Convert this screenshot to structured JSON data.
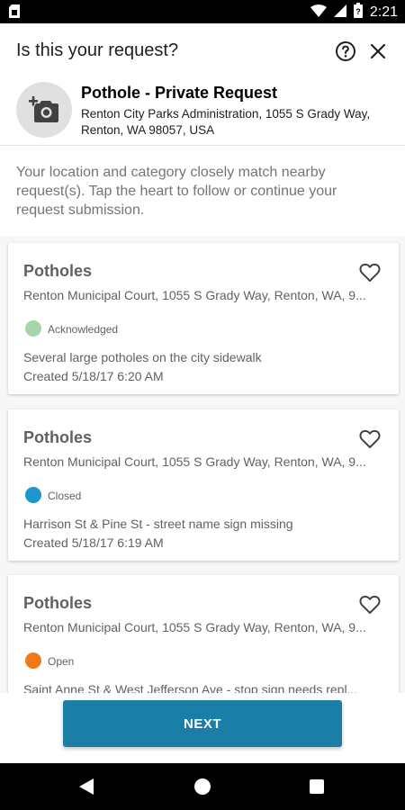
{
  "status_bar": {
    "time": "2:21",
    "icons": [
      "sim-card-icon",
      "wifi-icon",
      "signal-icon",
      "battery-icon"
    ]
  },
  "header": {
    "title": "Is this your request?",
    "help_icon": "help-circle-icon",
    "close_icon": "close-icon"
  },
  "request": {
    "icon": "add-photo-icon",
    "title": "Pothole - Private Request",
    "address": "Renton City Parks Administration, 1055 S Grady Way, Renton, WA 98057, USA"
  },
  "intro": "Your location and category closely match nearby request(s). Tap the heart to follow or continue your request submission.",
  "cards": [
    {
      "title": "Potholes",
      "address": "Renton Municipal Court, 1055 S Grady Way, Renton, WA, 9...",
      "status": "Acknowledged",
      "status_color": "#a5d6a7",
      "description": "Several large potholes on the city sidewalk",
      "created": "Created 5/18/17 6:20 AM"
    },
    {
      "title": "Potholes",
      "address": "Renton Municipal Court, 1055 S Grady Way, Renton, WA, 9...",
      "status": "Closed",
      "status_color": "#1e96cf",
      "description": "Harrison St & Pine St - street name sign missing",
      "created": "Created 5/18/17 6:19 AM"
    },
    {
      "title": "Potholes",
      "address": "Renton Municipal Court, 1055 S Grady Way, Renton, WA, 9...",
      "status": "Open",
      "status_color": "#ef7a1a",
      "description": "Saint Anne St & West Jefferson Ave - stop sign needs repl...",
      "created": ""
    }
  ],
  "footer": {
    "next_label": "NEXT",
    "button_color": "#1a7ea6"
  },
  "nav_bar": {
    "icons": [
      "back-icon",
      "home-icon",
      "recents-icon"
    ]
  }
}
